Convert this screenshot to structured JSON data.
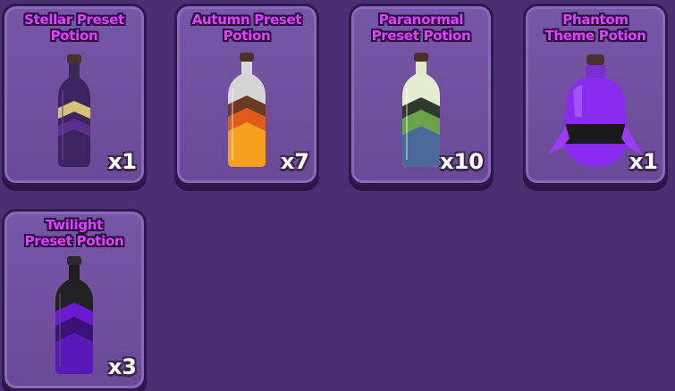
{
  "inventory": {
    "items": [
      {
        "name": "Stellar Preset\nPotion",
        "quantity": "x1",
        "icon": "stellar-preset-potion-icon"
      },
      {
        "name": "Autumn Preset\nPotion",
        "quantity": "x7",
        "icon": "autumn-preset-potion-icon"
      },
      {
        "name": "Paranormal\nPreset Potion",
        "quantity": "x10",
        "icon": "paranormal-preset-potion-icon"
      },
      {
        "name": "Phantom\nTheme Potion",
        "quantity": "x1",
        "icon": "phantom-theme-potion-icon"
      },
      {
        "name": "Twilight\nPreset Potion",
        "quantity": "x3",
        "icon": "twilight-preset-potion-icon"
      }
    ]
  },
  "colors": {
    "background": "#4a2f72",
    "card": "#7656a6",
    "title": "#e040ff"
  }
}
